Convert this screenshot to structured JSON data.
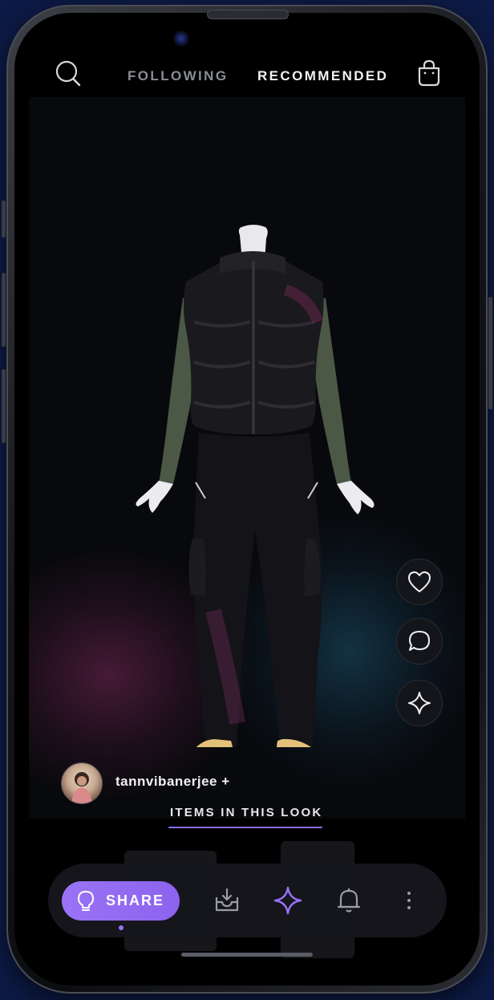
{
  "topbar": {
    "tab_following": "FOLLOWING",
    "tab_recommended": "RECOMMENDED",
    "active_tab": "RECOMMENDED",
    "search_icon": "search-icon",
    "bag_icon": "shopping-bag-icon"
  },
  "post": {
    "creator_username": "tannvibanerjee +",
    "actions": [
      "heart-icon",
      "comment-icon",
      "sparkle-icon"
    ]
  },
  "items_section": {
    "label": "ITEMS IN THIS LOOK"
  },
  "bottom_nav": {
    "share_label": "SHARE",
    "icons": [
      "lightbulb-icon",
      "inbox-download-icon",
      "sparkle-icon",
      "bell-icon",
      "more-vertical-icon"
    ],
    "accent_color": "#8b63ee"
  }
}
